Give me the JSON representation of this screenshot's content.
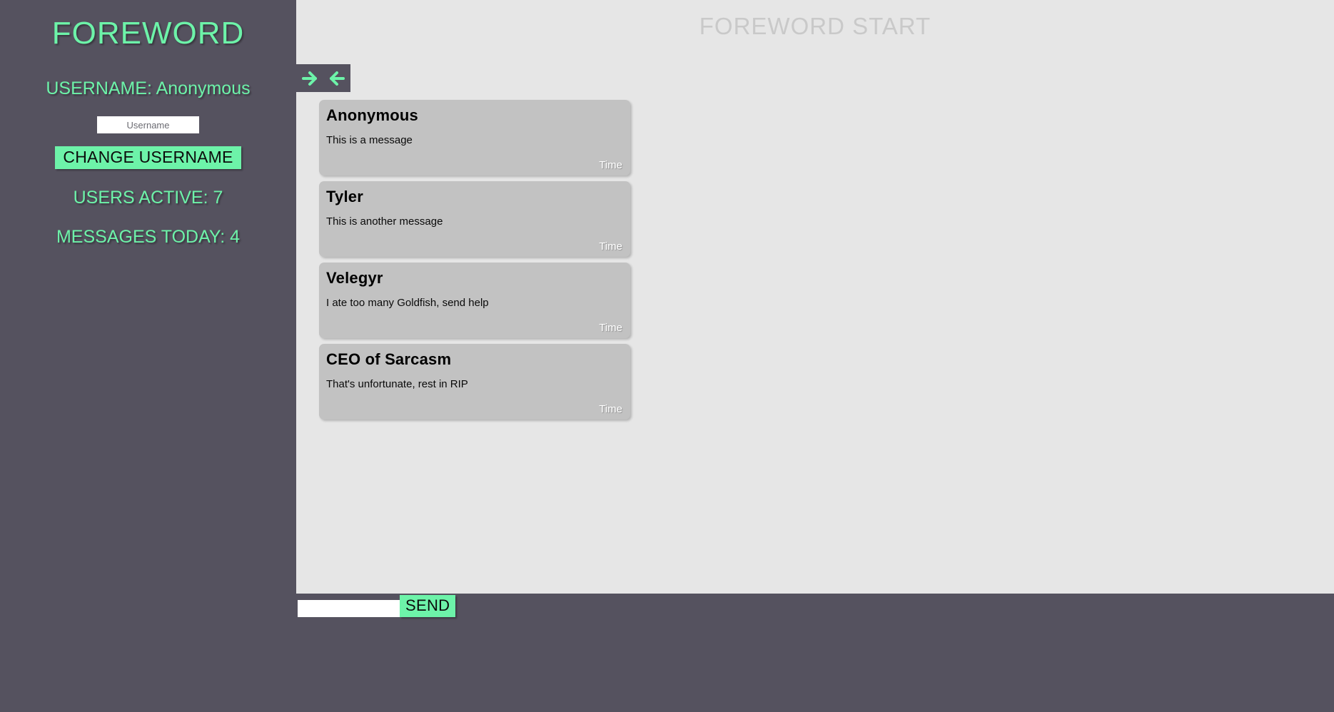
{
  "app": {
    "brand": "FOREWORD",
    "background_color": "#55525f",
    "accent_color": "#6df3a9",
    "chat_background_color": "#e6e6e6",
    "card_color": "#c2c2c2"
  },
  "sidebar": {
    "title": "FOREWORD",
    "username_label": "USERNAME:",
    "username_value": "Anonymous",
    "username_input": {
      "value": "",
      "placeholder": "Username"
    },
    "change_username_label": "CHANGE USERNAME",
    "users_active_label": "USERS ACTIVE:",
    "users_active_value": "7",
    "messages_today_label": "MESSAGES TODAY:",
    "messages_today_value": "4"
  },
  "main": {
    "heading": "FOREWORD START",
    "nav": {
      "forward_icon": "arrow-right-icon",
      "back_icon": "arrow-left-icon"
    },
    "messages": [
      {
        "author": "Anonymous",
        "text": "This is a message",
        "time": "Time"
      },
      {
        "author": "Tyler",
        "text": "This is another message",
        "time": "Time"
      },
      {
        "author": "Velegyr",
        "text": "I ate too many Goldfish, send help",
        "time": "Time"
      },
      {
        "author": "CEO of Sarcasm",
        "text": "That's unfortunate, rest in RIP",
        "time": "Time"
      }
    ]
  },
  "composer": {
    "input": {
      "value": "",
      "placeholder": ""
    },
    "send_label": "SEND"
  }
}
